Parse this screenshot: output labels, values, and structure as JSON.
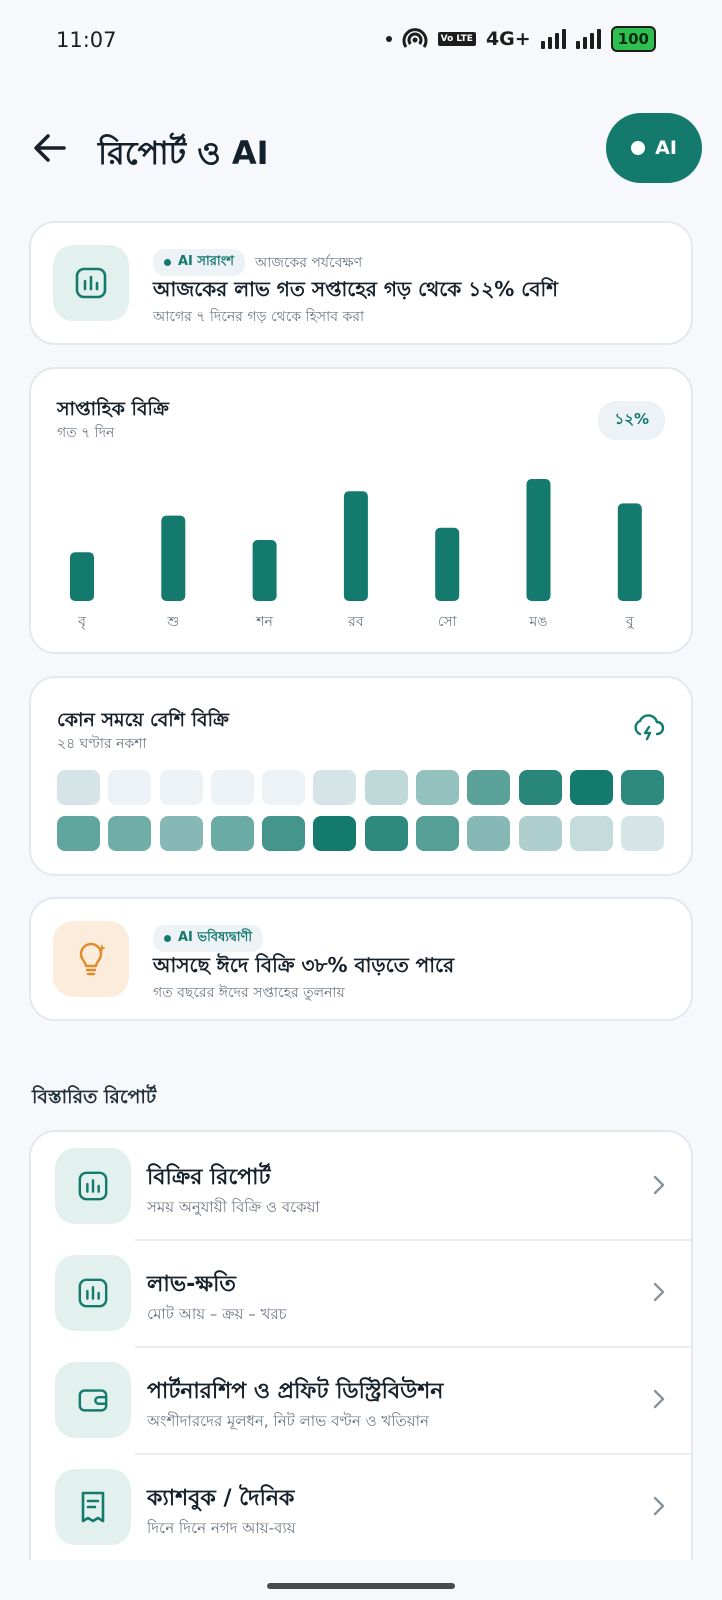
{
  "status": {
    "time": "11:07",
    "network": "4G+",
    "volte": "Vo LTE",
    "battery": "100"
  },
  "header": {
    "title": "রিপোর্ট ও AI",
    "ai_button": "AI"
  },
  "summary": {
    "badge": "AI সারাংশ",
    "badge_note": "আজকের পর্যবেক্ষণ",
    "title": "আজকের লাভ গত সপ্তাহের গড় থেকে ১২% বেশি",
    "subtitle": "আগের ৭ দিনের গড় থেকে হিসাব করা"
  },
  "weekly": {
    "title": "সাপ্তাহিক বিক্রি",
    "subtitle": "গত ৭ দিন",
    "badge": "১২%"
  },
  "chart_data": {
    "type": "bar",
    "categories": [
      "বৃ",
      "শু",
      "শন",
      "রব",
      "সো",
      "মঙ",
      "বু"
    ],
    "values": [
      40,
      70,
      50,
      90,
      60,
      100,
      80
    ],
    "title": "সাপ্তাহিক বিক্রি",
    "xlabel": "",
    "ylabel": "",
    "ylim": [
      0,
      100
    ],
    "grid": false,
    "bar_color": "#137a6d"
  },
  "heatmap": {
    "title": "কোন সময়ে বেশি বিক্রি",
    "subtitle": "২৪ ঘণ্টার নকশা",
    "icon": "cloud-lightning-icon",
    "intensities": [
      0.12,
      0.02,
      0.02,
      0.02,
      0.02,
      0.12,
      0.22,
      0.42,
      0.68,
      0.9,
      1.0,
      0.88,
      0.65,
      0.58,
      0.48,
      0.6,
      0.78,
      1.0,
      0.88,
      0.7,
      0.48,
      0.3,
      0.2,
      0.12
    ]
  },
  "forecast": {
    "badge": "AI ভবিষ্যদ্বাণী",
    "title": "আসছে ঈদে বিক্রি ৩৮% বাড়তে পারে",
    "subtitle": "গত বছরের ঈদের সপ্তাহের তুলনায়"
  },
  "reports": {
    "section_title": "বিস্তারিত রিপোর্ট",
    "items": [
      {
        "title": "বিক্রির রিপোর্ট",
        "subtitle": "সময় অনুযায়ী বিক্রি ও বকেয়া",
        "icon": "bar-chart-icon"
      },
      {
        "title": "লাভ-ক্ষতি",
        "subtitle": "মোট আয় – ক্রয় – খরচ",
        "icon": "bar-chart-icon"
      },
      {
        "title": "পার্টনারশিপ ও প্রফিট ডিস্ট্রিবিউশন",
        "subtitle": "অংশীদারদের মূলধন, নিট লাভ বণ্টন ও খতিয়ান",
        "icon": "wallet-icon"
      },
      {
        "title": "ক্যাশবুক / দৈনিক",
        "subtitle": "দিনে দিনে নগদ আয়-ব্যয়",
        "icon": "receipt-icon"
      }
    ]
  },
  "colors": {
    "accent": "#137a6d",
    "background": "#f6f8fb",
    "orange": "#e08a2a"
  }
}
